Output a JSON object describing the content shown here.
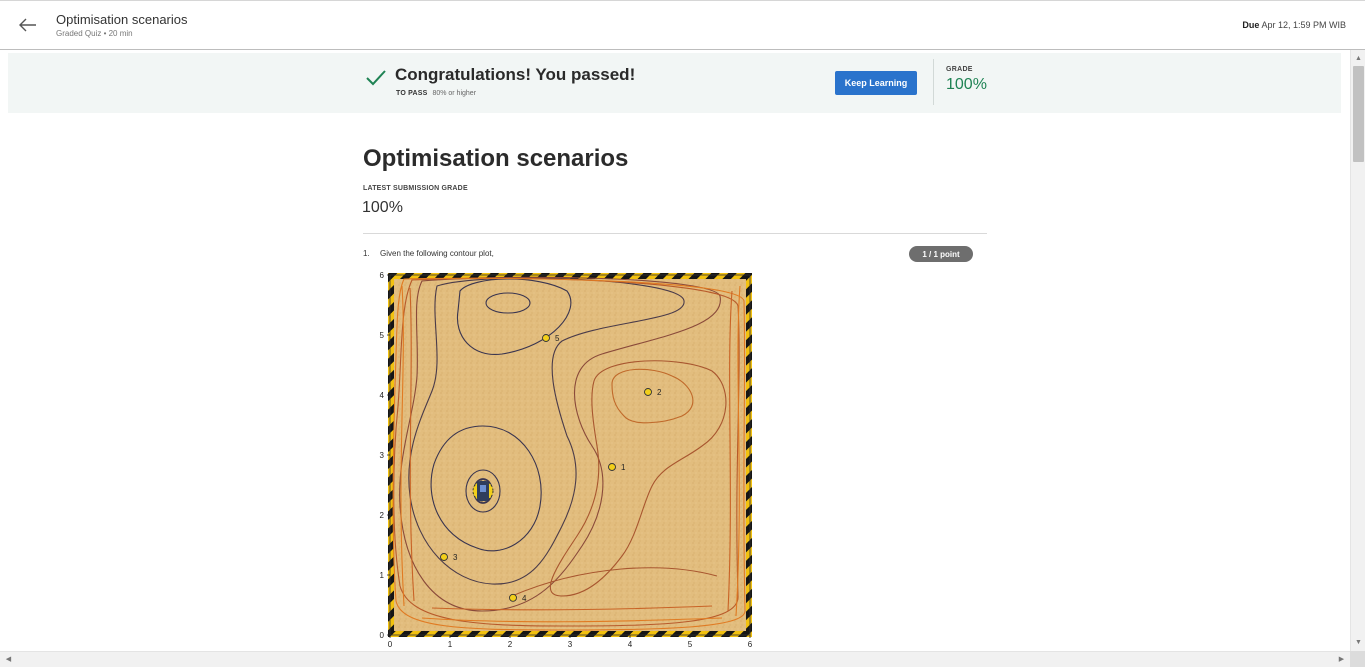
{
  "header": {
    "back_icon": "arrow-left-icon",
    "title": "Optimisation scenarios",
    "subtitle": "Graded Quiz • 20 min",
    "due_label": "Due",
    "due_value": "Apr 12, 1:59 PM WIB"
  },
  "banner": {
    "check_icon": "checkmark-icon",
    "congrats": "Congratulations! You passed!",
    "to_pass_label": "TO PASS",
    "to_pass_value": "80% or higher",
    "keep_learning": "Keep Learning",
    "grade_label": "GRADE",
    "grade_value": "100%"
  },
  "main": {
    "title": "Optimisation scenarios",
    "latest_grade_label": "LATEST SUBMISSION GRADE",
    "latest_grade_value": "100%"
  },
  "question": {
    "number": "1.",
    "text": "Given the following contour plot,",
    "points": "1 / 1 point"
  },
  "plot": {
    "x_ticks": [
      "0",
      "1",
      "2",
      "3",
      "4",
      "5",
      "6"
    ],
    "y_ticks": [
      "0",
      "1",
      "2",
      "3",
      "4",
      "5",
      "6"
    ],
    "points": [
      {
        "label": "1",
        "x": 3.7,
        "y": 2.8
      },
      {
        "label": "2",
        "x": 4.3,
        "y": 4.05
      },
      {
        "label": "3",
        "x": 0.9,
        "y": 1.3
      },
      {
        "label": "4",
        "x": 2.05,
        "y": 0.62
      },
      {
        "label": "5",
        "x": 2.6,
        "y": 4.95
      }
    ],
    "colors": {
      "sand": "#e2bd7e",
      "point_fill": "#f2cf1a",
      "contour_dark": "#3a3550",
      "contour_mid": "#8a4a3a",
      "contour_light": "#e07a22"
    }
  },
  "colors": {
    "accent": "#2a73cc",
    "pass_green": "#1f8354",
    "banner_bg": "#f2f6f5"
  }
}
